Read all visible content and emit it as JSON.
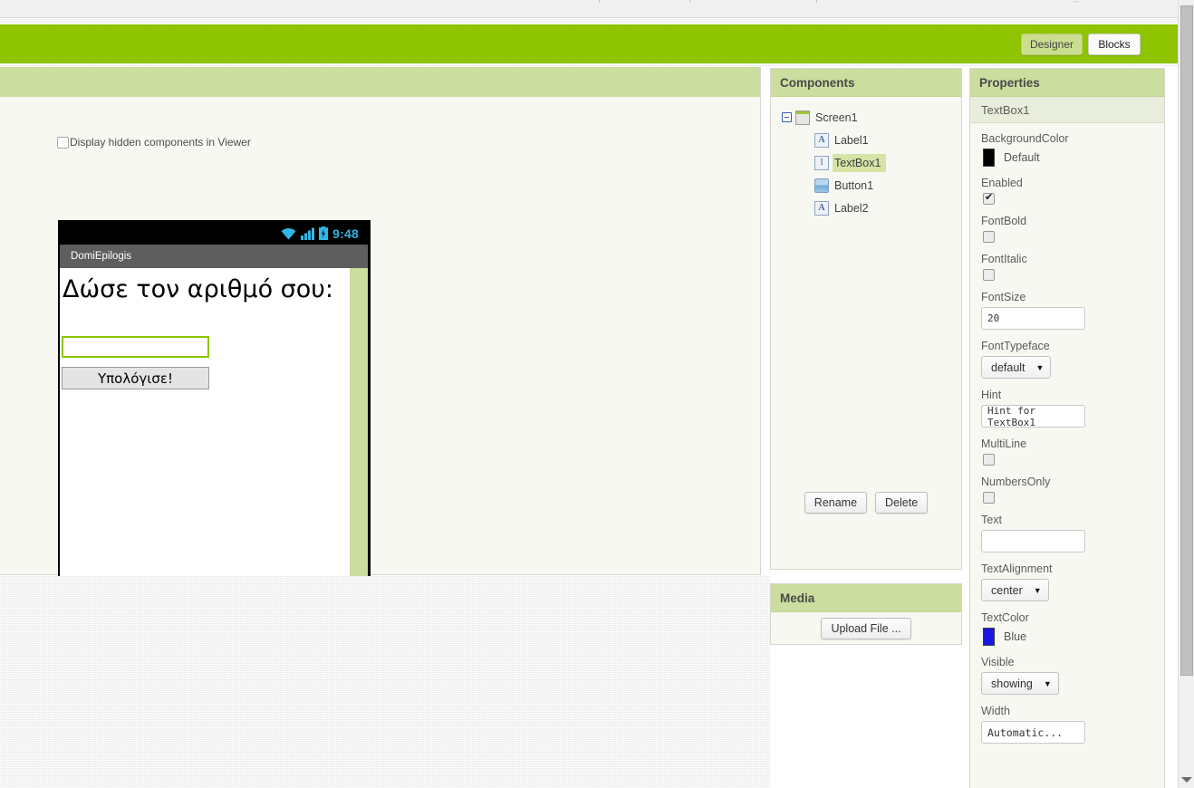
{
  "toolbar": {
    "ghost_fragments": [
      "|",
      "|",
      "|",
      "_-"
    ],
    "tabs": [
      {
        "label": "Designer",
        "selected": true
      },
      {
        "label": "Blocks",
        "selected": false
      }
    ]
  },
  "viewer": {
    "display_hidden_label": "Display hidden components in Viewer",
    "display_hidden_checked": false,
    "phone": {
      "status_time": "9:48",
      "status_icons": [
        "wifi-icon",
        "signal-icon",
        "battery-icon"
      ],
      "status_icon_color": "#33b5e5",
      "app_title": "DomiEpilogis",
      "label1_text": "Δώσε τον αριθμό σου:",
      "textbox1_value": "",
      "textbox1_selected": true,
      "button1_text": "Υπολόγισε!",
      "selection_color": "#8ec400",
      "strip_color": "#cbdd9f"
    }
  },
  "components": {
    "title": "Components",
    "tree": [
      {
        "label": "Screen1",
        "icon": "screen-icon",
        "level": 0,
        "selected": false,
        "expanded": true
      },
      {
        "label": "Label1",
        "icon": "label-icon",
        "level": 1,
        "selected": false,
        "glyph": "A"
      },
      {
        "label": "TextBox1",
        "icon": "textbox-icon",
        "level": 1,
        "selected": true,
        "glyph": "I"
      },
      {
        "label": "Button1",
        "icon": "button-icon",
        "level": 1,
        "selected": false,
        "glyph": ""
      },
      {
        "label": "Label2",
        "icon": "label-icon",
        "level": 1,
        "selected": false,
        "glyph": "A"
      }
    ],
    "rename_label": "Rename",
    "delete_label": "Delete"
  },
  "media": {
    "title": "Media",
    "upload_label": "Upload File ..."
  },
  "properties": {
    "title": "Properties",
    "component_name": "TextBox1",
    "rows": [
      {
        "label": "BackgroundColor",
        "type": "color",
        "value": "Default",
        "swatch": "#000000"
      },
      {
        "label": "Enabled",
        "type": "checkbox",
        "checked": true
      },
      {
        "label": "FontBold",
        "type": "checkbox",
        "checked": false
      },
      {
        "label": "FontItalic",
        "type": "checkbox",
        "checked": false
      },
      {
        "label": "FontSize",
        "type": "text",
        "value": "20"
      },
      {
        "label": "FontTypeface",
        "type": "select",
        "value": "default"
      },
      {
        "label": "Hint",
        "type": "text",
        "value": "Hint for TextBox1"
      },
      {
        "label": "MultiLine",
        "type": "checkbox",
        "checked": false
      },
      {
        "label": "NumbersOnly",
        "type": "checkbox",
        "checked": false
      },
      {
        "label": "Text",
        "type": "text",
        "value": ""
      },
      {
        "label": "TextAlignment",
        "type": "select",
        "value": "center"
      },
      {
        "label": "TextColor",
        "type": "color",
        "value": "Blue",
        "swatch": "#1818e0"
      },
      {
        "label": "Visible",
        "type": "select",
        "value": "showing"
      },
      {
        "label": "Width",
        "type": "button",
        "value": "Automatic..."
      }
    ]
  },
  "theme": {
    "accent_green": "#8ec400",
    "panel_header_green": "#cbdd9f",
    "panel_bg": "#f8f8f2"
  }
}
